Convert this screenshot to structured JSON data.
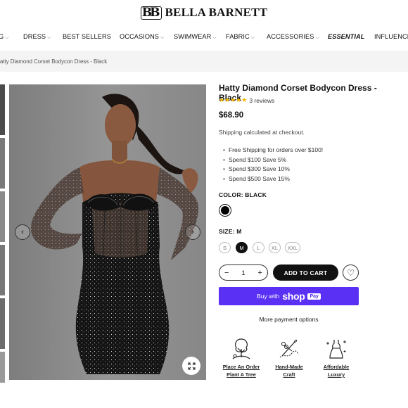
{
  "brand": {
    "name": "BELLA BARNETT",
    "mark": "BB"
  },
  "nav": {
    "items": [
      {
        "label": "G",
        "dropdown": true
      },
      {
        "label": "DRESS",
        "dropdown": true
      },
      {
        "label": "BEST SELLERS",
        "dropdown": false
      },
      {
        "label": "OCCASIONS",
        "dropdown": true
      },
      {
        "label": "SWIMWEAR",
        "dropdown": true
      },
      {
        "label": "FABRIC",
        "dropdown": true
      },
      {
        "label": "ACCESSORIES",
        "dropdown": true
      },
      {
        "label": "ESSENTIAL",
        "dropdown": false
      },
      {
        "label": "INFLUENCER",
        "dropdown": false
      }
    ]
  },
  "breadcrumb": "atty Diamond Corset Bodycon Dress - Black",
  "product": {
    "title": "Hatty Diamond Corset Bodycon Dress - Black",
    "rating_stars": 5,
    "reviews": "3 reviews",
    "price": "$68.90",
    "shipping_note": "Shipping calculated at checkout.",
    "promos": [
      "Free Shipping for orders over $100!",
      "Spend $100 Save 5%",
      "Spend $300 Save 10%",
      "Spend $500 Save 15%"
    ],
    "color_label": "COLOR: BLACK",
    "size_label": "SIZE: M",
    "sizes": [
      "S",
      "M",
      "L",
      "XL",
      "XXL"
    ],
    "selected_size": "M",
    "quantity": "1",
    "add_to_cart": "ADD TO CART",
    "shop_pay": {
      "buy_with": "Buy with",
      "shop": "shop",
      "pay": "Pay"
    },
    "more_payment": "More payment options"
  },
  "features": [
    {
      "line1": "Place An Order",
      "line2": "Plant A Tree",
      "icon": "tree-icon"
    },
    {
      "line1": "Hand-Made",
      "line2": "Craft",
      "icon": "sewing-icon"
    },
    {
      "line1": "Affordable",
      "line2": "Luxury",
      "icon": "dress-sparkle-icon"
    }
  ],
  "colors": {
    "accent": "#5a31f4",
    "stars": "#f0b400",
    "button": "#111111",
    "crumb_bg": "#f4f4f4"
  }
}
